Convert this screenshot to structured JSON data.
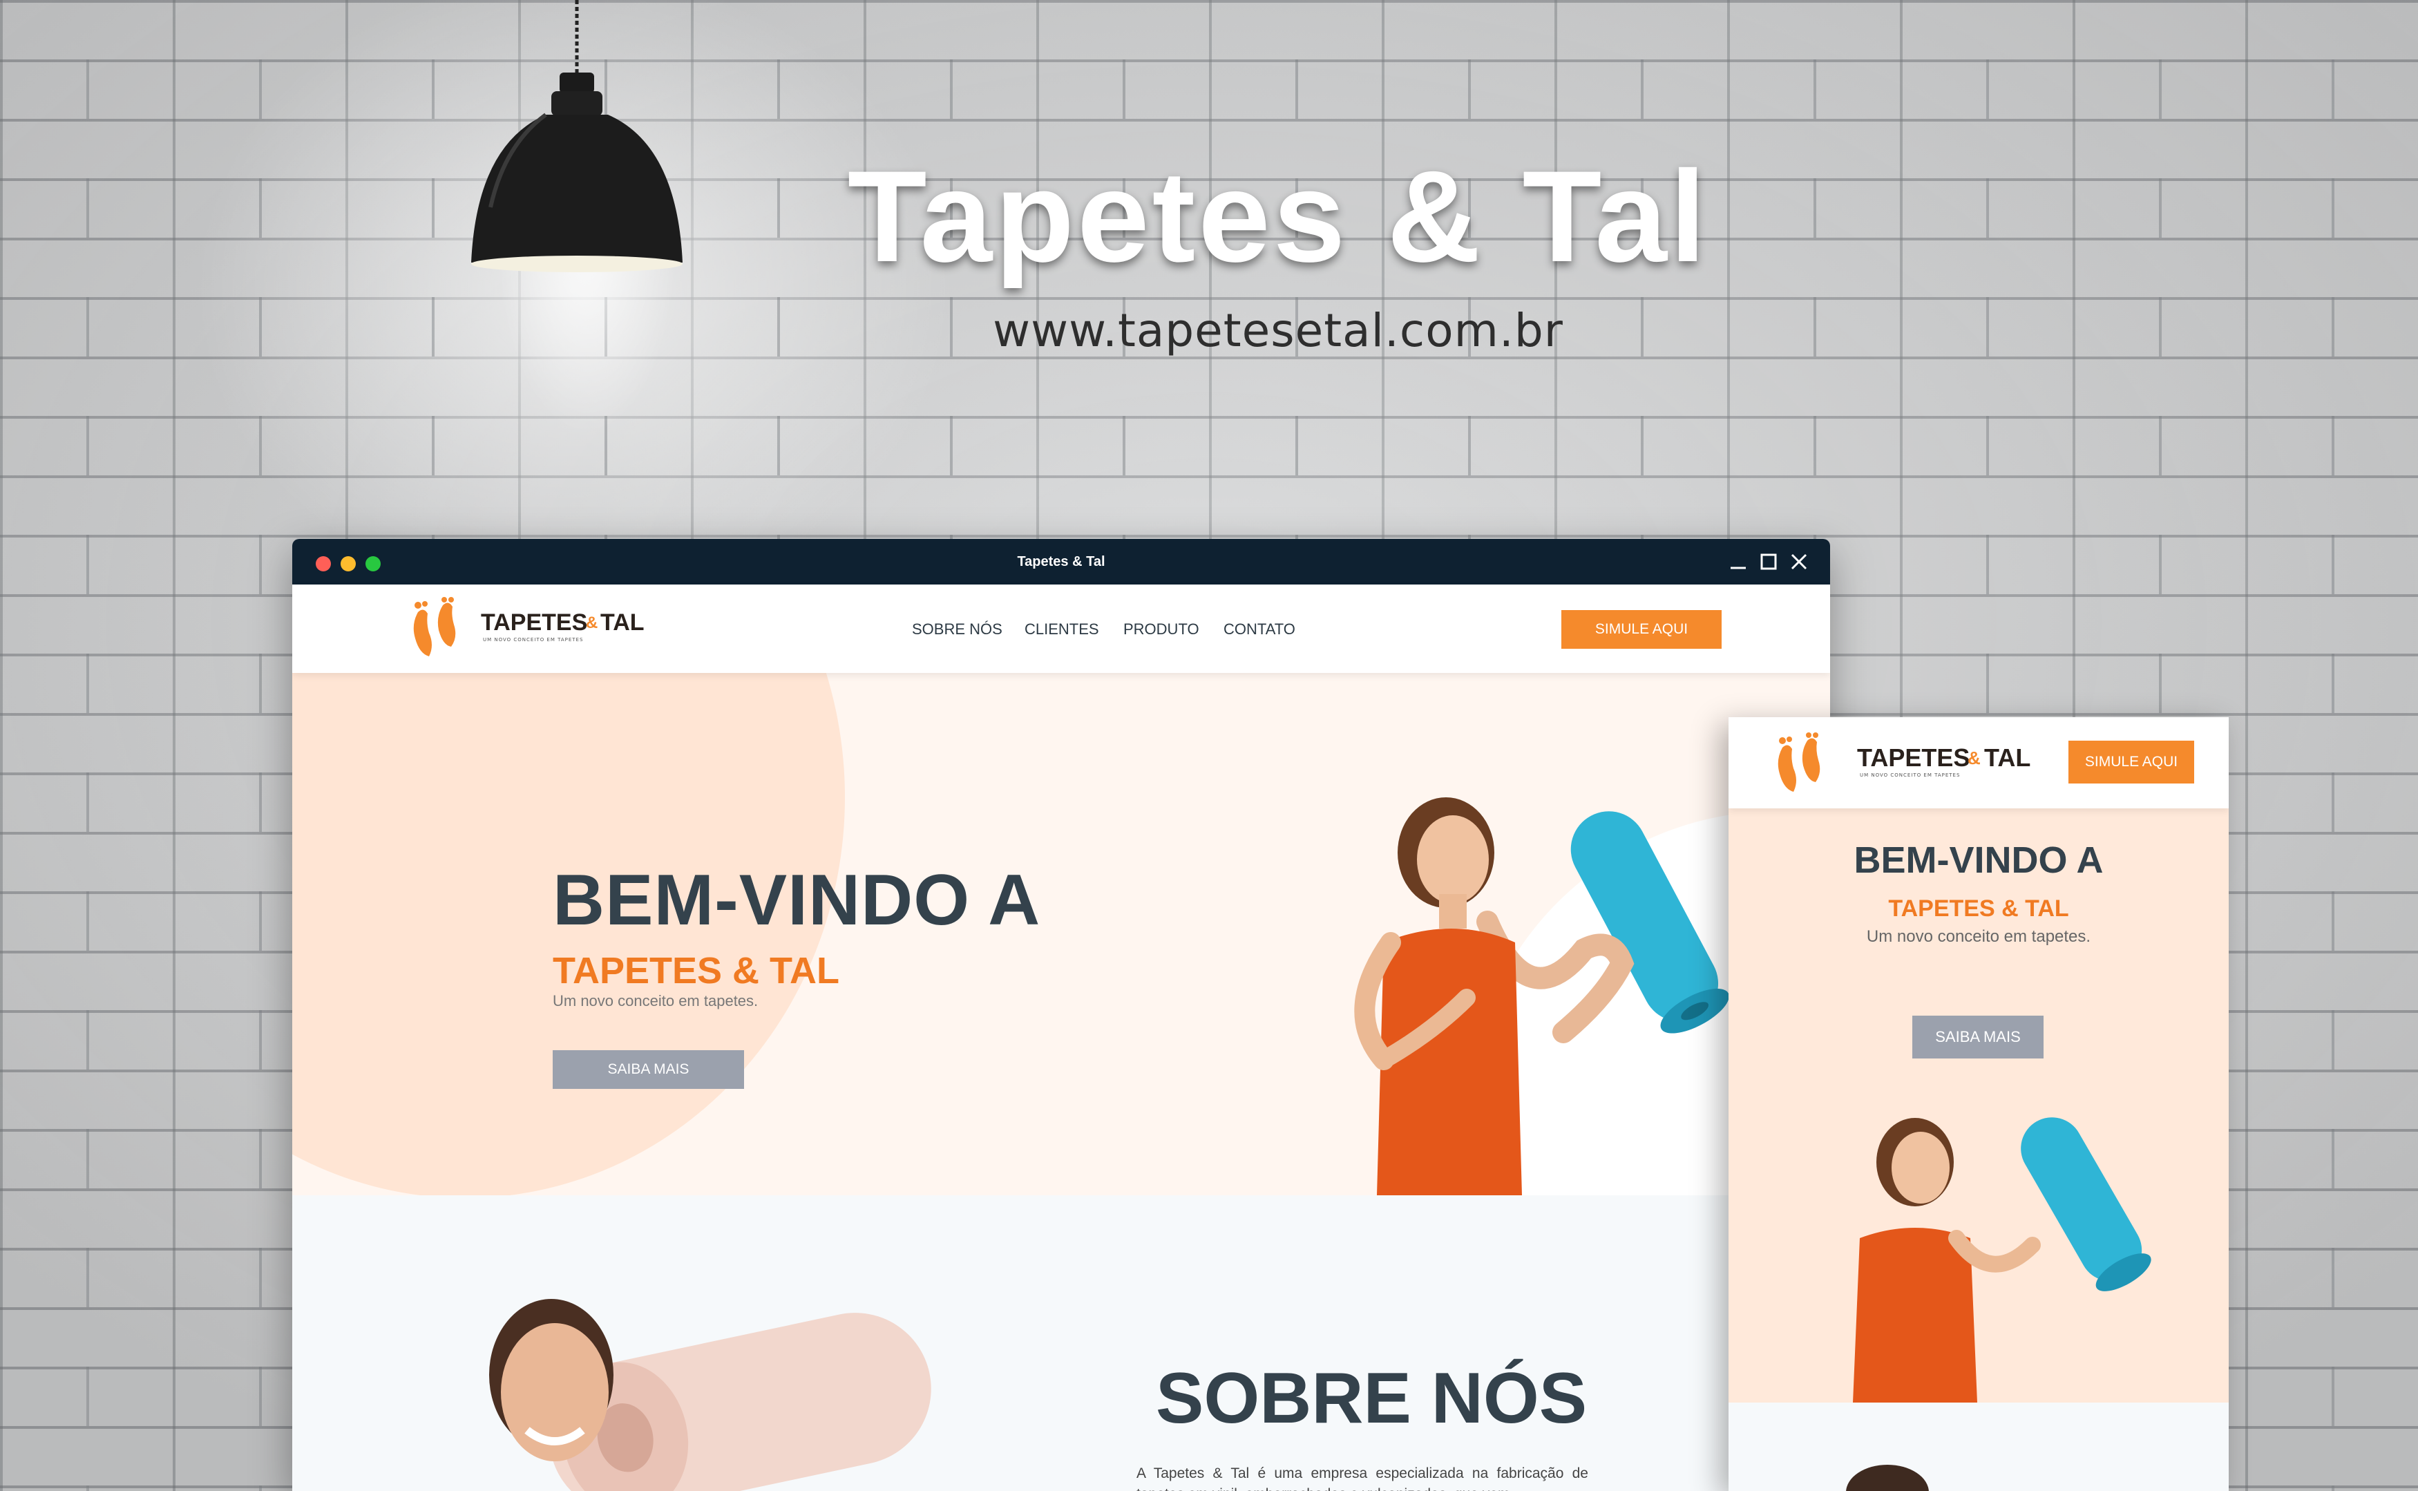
{
  "showcase": {
    "title": "Tapetes & Tal",
    "url": "www.tapetesetal.com.br"
  },
  "window": {
    "title": "Tapetes & Tal",
    "controls": [
      "minimize-icon",
      "maximize-icon",
      "close-icon"
    ]
  },
  "brand": {
    "name_main": "TAPETES",
    "name_amp": "&",
    "name_end": "TAL",
    "tagline": "UM NOVO CONCEITO EM TAPETES",
    "logo_icon": "feet-icon"
  },
  "nav": {
    "items": [
      "SOBRE NÓS",
      "CLIENTES",
      "PRODUTO",
      "CONTATO"
    ],
    "cta": "SIMULE AQUI"
  },
  "hero": {
    "heading": "BEM-VINDO A",
    "subheading": "TAPETES & TAL",
    "text": "Um novo conceito em tapetes.",
    "button": "SAIBA MAIS"
  },
  "about": {
    "heading": "SOBRE NÓS",
    "text": "A Tapetes & Tal é uma empresa especializada na fabricação de tapetes em vinil, emborrachados e vulcanizados, que vem"
  },
  "mobile": {
    "cta": "SIMULE AQUI",
    "heading": "BEM-VINDO A",
    "subheading": "TAPETES & TAL",
    "text": "Um novo conceito em tapetes.",
    "button": "SAIBA MAIS"
  },
  "colors": {
    "accent": "#f58a2c",
    "heading": "#34424c",
    "titlebar": "#0e2131",
    "hero_bg": "#fff6f0",
    "button_grey": "#9ba1ad"
  }
}
